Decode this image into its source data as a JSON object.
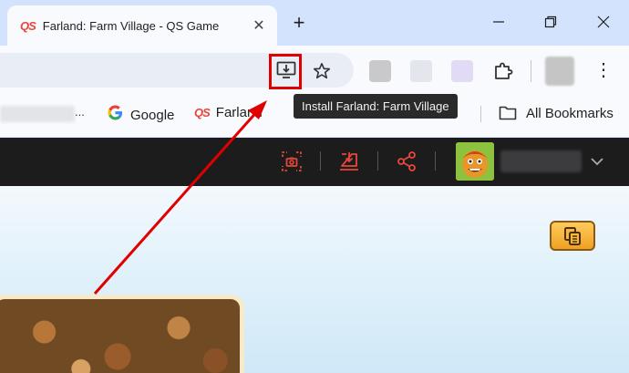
{
  "tab": {
    "favicon": "QS",
    "title": "Farland: Farm Village - QS Game",
    "close": "✕"
  },
  "new_tab": "+",
  "toolbar": {
    "install_icon": "install-app-icon",
    "bookmark_icon": "star-icon",
    "menu": "⋮"
  },
  "tooltip": {
    "text": "Install Farland: Farm Village"
  },
  "bookmarks": {
    "overflow": "...",
    "items": [
      {
        "label": "Google",
        "icon": "G"
      },
      {
        "label": "Farland",
        "icon": "QS"
      }
    ],
    "all_label": "All Bookmarks"
  },
  "game_bar": {
    "icons": [
      "screenshot-icon",
      "download-icon",
      "share-icon"
    ],
    "accent_color": "#e8463a"
  },
  "annotation": {
    "highlight_color": "#e00000"
  }
}
